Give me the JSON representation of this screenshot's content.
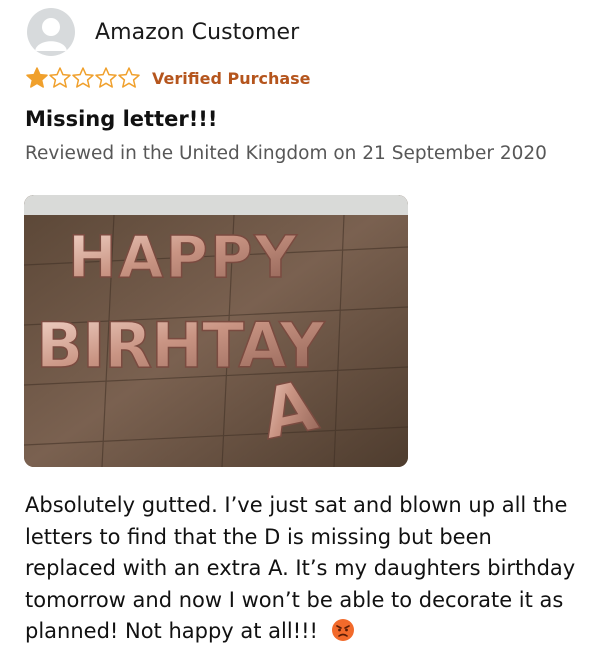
{
  "reviewer": {
    "name": "Amazon Customer",
    "avatar_icon": "default-user-avatar-icon"
  },
  "rating": {
    "stars_filled": 1,
    "stars_total": 5,
    "star_color": "#f0a02c",
    "verified_label": "Verified Purchase",
    "verified_color": "#b5551d"
  },
  "review": {
    "title": "Missing letter!!!",
    "date_text": "Reviewed in the United Kingdom on 21 September 2020",
    "photo": {
      "balloon_letters_row1": "HAPPY",
      "balloon_letters_row2": "BIRHTAY",
      "balloon_letters_row3": "A"
    },
    "body": "Absolutely gutted. I’ve just sat and blown up all the letters to find that the D is missing but been replaced with an extra A. It’s my daughters birthday tomorrow and now I won’t be able to decorate it as planned! Not happy at all!!!",
    "emoji_icon": "angry-face-icon"
  }
}
